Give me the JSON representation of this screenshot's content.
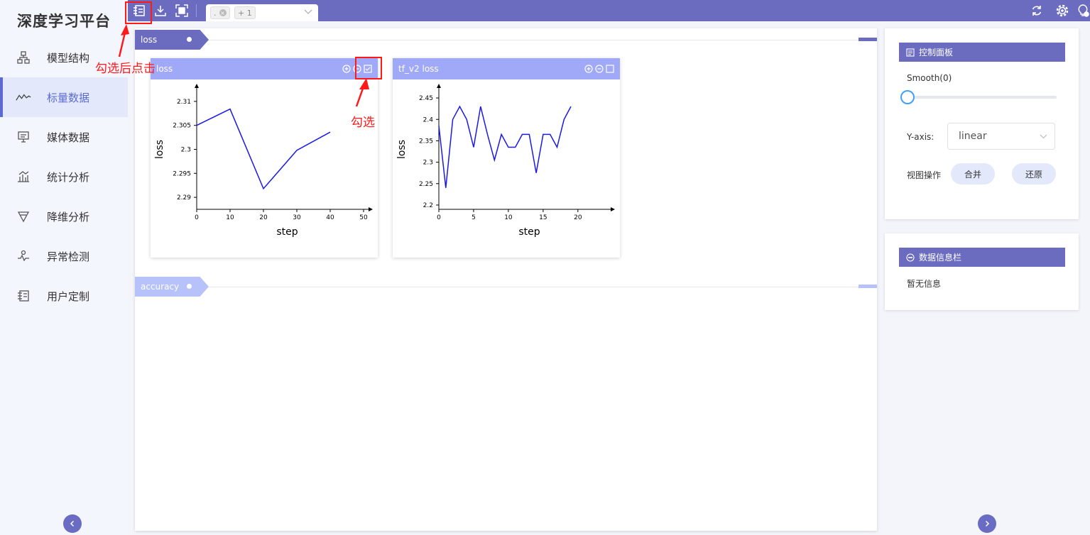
{
  "app": {
    "title": "深度学习平台"
  },
  "sidebar": {
    "items": [
      {
        "label": "模型结构",
        "icon": "model-structure-icon"
      },
      {
        "label": "标量数据",
        "icon": "scalar-line-icon",
        "active": true
      },
      {
        "label": "媒体数据",
        "icon": "monitor-icon"
      },
      {
        "label": "统计分析",
        "icon": "bar-stats-icon"
      },
      {
        "label": "降维分析",
        "icon": "funnel-icon"
      },
      {
        "label": "异常检测",
        "icon": "pulse-icon"
      },
      {
        "label": "用户定制",
        "icon": "custom-board-icon"
      }
    ]
  },
  "topbar": {
    "tab_tags": [
      ".",
      "+ 1"
    ]
  },
  "sections": [
    {
      "label": "loss"
    },
    {
      "label": "accuracy"
    }
  ],
  "cards": [
    {
      "title": "loss",
      "chart_data": {
        "type": "line",
        "xlabel": "step",
        "ylabel": "loss",
        "xlim": [
          0,
          50
        ],
        "ylim": [
          2.2875,
          2.3125
        ],
        "x_ticks": [
          0,
          10,
          20,
          30,
          40,
          50
        ],
        "y_ticks": [
          2.29,
          2.295,
          2.3,
          2.305,
          2.31
        ],
        "series": [
          {
            "x": [
              0,
              10,
              20,
              30,
              40
            ],
            "y": [
              2.305,
              2.3084,
              2.2918,
              2.2998,
              2.3036
            ]
          }
        ]
      }
    },
    {
      "title": "tf_v2 loss",
      "chart_data": {
        "type": "line",
        "xlabel": "step",
        "ylabel": "loss",
        "xlim": [
          0,
          24
        ],
        "ylim": [
          2.19,
          2.47
        ],
        "x_ticks": [
          0,
          5,
          10,
          15,
          20
        ],
        "y_ticks": [
          2.2,
          2.25,
          2.3,
          2.35,
          2.4,
          2.45
        ],
        "series": [
          {
            "x": [
              0,
              1,
              2,
              3,
              4,
              5,
              6,
              7,
              8,
              9,
              10,
              11,
              12,
              13,
              14,
              15,
              16,
              17,
              18,
              19
            ],
            "y": [
              2.385,
              2.24,
              2.4,
              2.43,
              2.4,
              2.335,
              2.43,
              2.365,
              2.305,
              2.365,
              2.335,
              2.335,
              2.365,
              2.365,
              2.275,
              2.365,
              2.365,
              2.335,
              2.4,
              2.43
            ]
          }
        ]
      }
    }
  ],
  "control_panel": {
    "title": "控制面板",
    "smooth_label": "Smooth(0)",
    "smooth_value": 0,
    "yaxis_label": "Y-axis:",
    "yaxis_value": "linear",
    "view_label": "视图操作",
    "merge_button": "合并",
    "restore_button": "还原"
  },
  "info_panel": {
    "title": "数据信息栏",
    "empty_text": "暂无信息"
  },
  "annotations": {
    "click_after_check": "勾选后点击",
    "check": "勾选"
  },
  "colors": {
    "accent": "#6b6cc0",
    "card_header": "#a0a9f8",
    "line": "#1a1ae6",
    "annotation": "#ff1a1a"
  }
}
